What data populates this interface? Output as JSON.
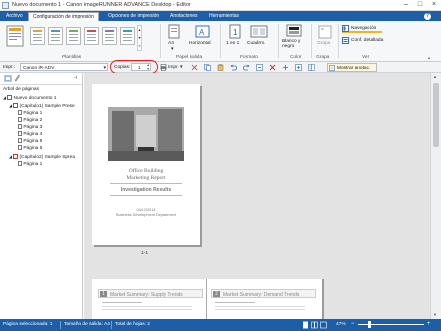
{
  "window": {
    "title": "Nuevo documento 1 - Canon imageRUNNER ADVANCE Desktop - Editor"
  },
  "ribbon_tabs": [
    {
      "label": "Archivo"
    },
    {
      "label": "Configuración de impresión"
    },
    {
      "label": "Opciones de impresión"
    },
    {
      "label": "Anotaciones"
    },
    {
      "label": "Herramientas"
    }
  ],
  "ribbon": {
    "groups": {
      "plantillas": "Plantillas",
      "papel_salida": "Papel salida",
      "formato": "Formato",
      "color": "Color",
      "grapa": "Grapa",
      "ver": "Ver"
    },
    "paper_size": "A4",
    "orientation": "Horizontal",
    "pages_per_sheet": "1 en 1",
    "custom": "Cuadrm.",
    "color_mode": "Blanco y negro",
    "staple": "Grapa",
    "navigation": "Navegación",
    "conf_detallada": "Conf. detallada"
  },
  "toolbar": {
    "printer_label": "Impr.:",
    "printer_value": "Canon iR-ADV",
    "copies_label": "Copias:",
    "copies_value": "1",
    "print_label": "Impr.",
    "show_annotations": "Mostrar anotac."
  },
  "left_panel": {
    "title": "Árbol de páginas",
    "tree": [
      {
        "label": "Nuevo documento 1",
        "level": 0
      },
      {
        "label": "(Capítulo1) Sample Prese",
        "level": 1
      },
      {
        "label": "Página 1",
        "level": 2
      },
      {
        "label": "Página 2",
        "level": 2
      },
      {
        "label": "Página 3",
        "level": 2
      },
      {
        "label": "Página 4",
        "level": 2
      },
      {
        "label": "Página 5",
        "level": 2
      },
      {
        "label": "Página 6",
        "level": 2
      },
      {
        "label": "(Capítulo2) Sample Sprea",
        "level": 1
      },
      {
        "label": "Página 1",
        "level": 2
      }
    ]
  },
  "preview": {
    "page1": {
      "title_line1": "Office Building",
      "title_line2": "Marketing Report",
      "subtitle": "Investigation Results",
      "date": "04/12/2014",
      "dept": "Business Development Department",
      "caption": "1-1"
    },
    "page2": {
      "left_heading": "Market Summary: Supply Trends",
      "right_heading": "Market Summary: Demand Trends",
      "left_number": "1",
      "right_number": "2"
    }
  },
  "status": {
    "selected_page": "Página seleccionada: 1",
    "output_size": "Tamaño de salida: A4",
    "total_sheets": "Total de hojas: 2",
    "zoom": "47%"
  },
  "colors": {
    "accent": "#1c5fa8",
    "highlight_circle": "#e0201b",
    "navigation_underline": "#f0b429"
  },
  "chart_data": null
}
